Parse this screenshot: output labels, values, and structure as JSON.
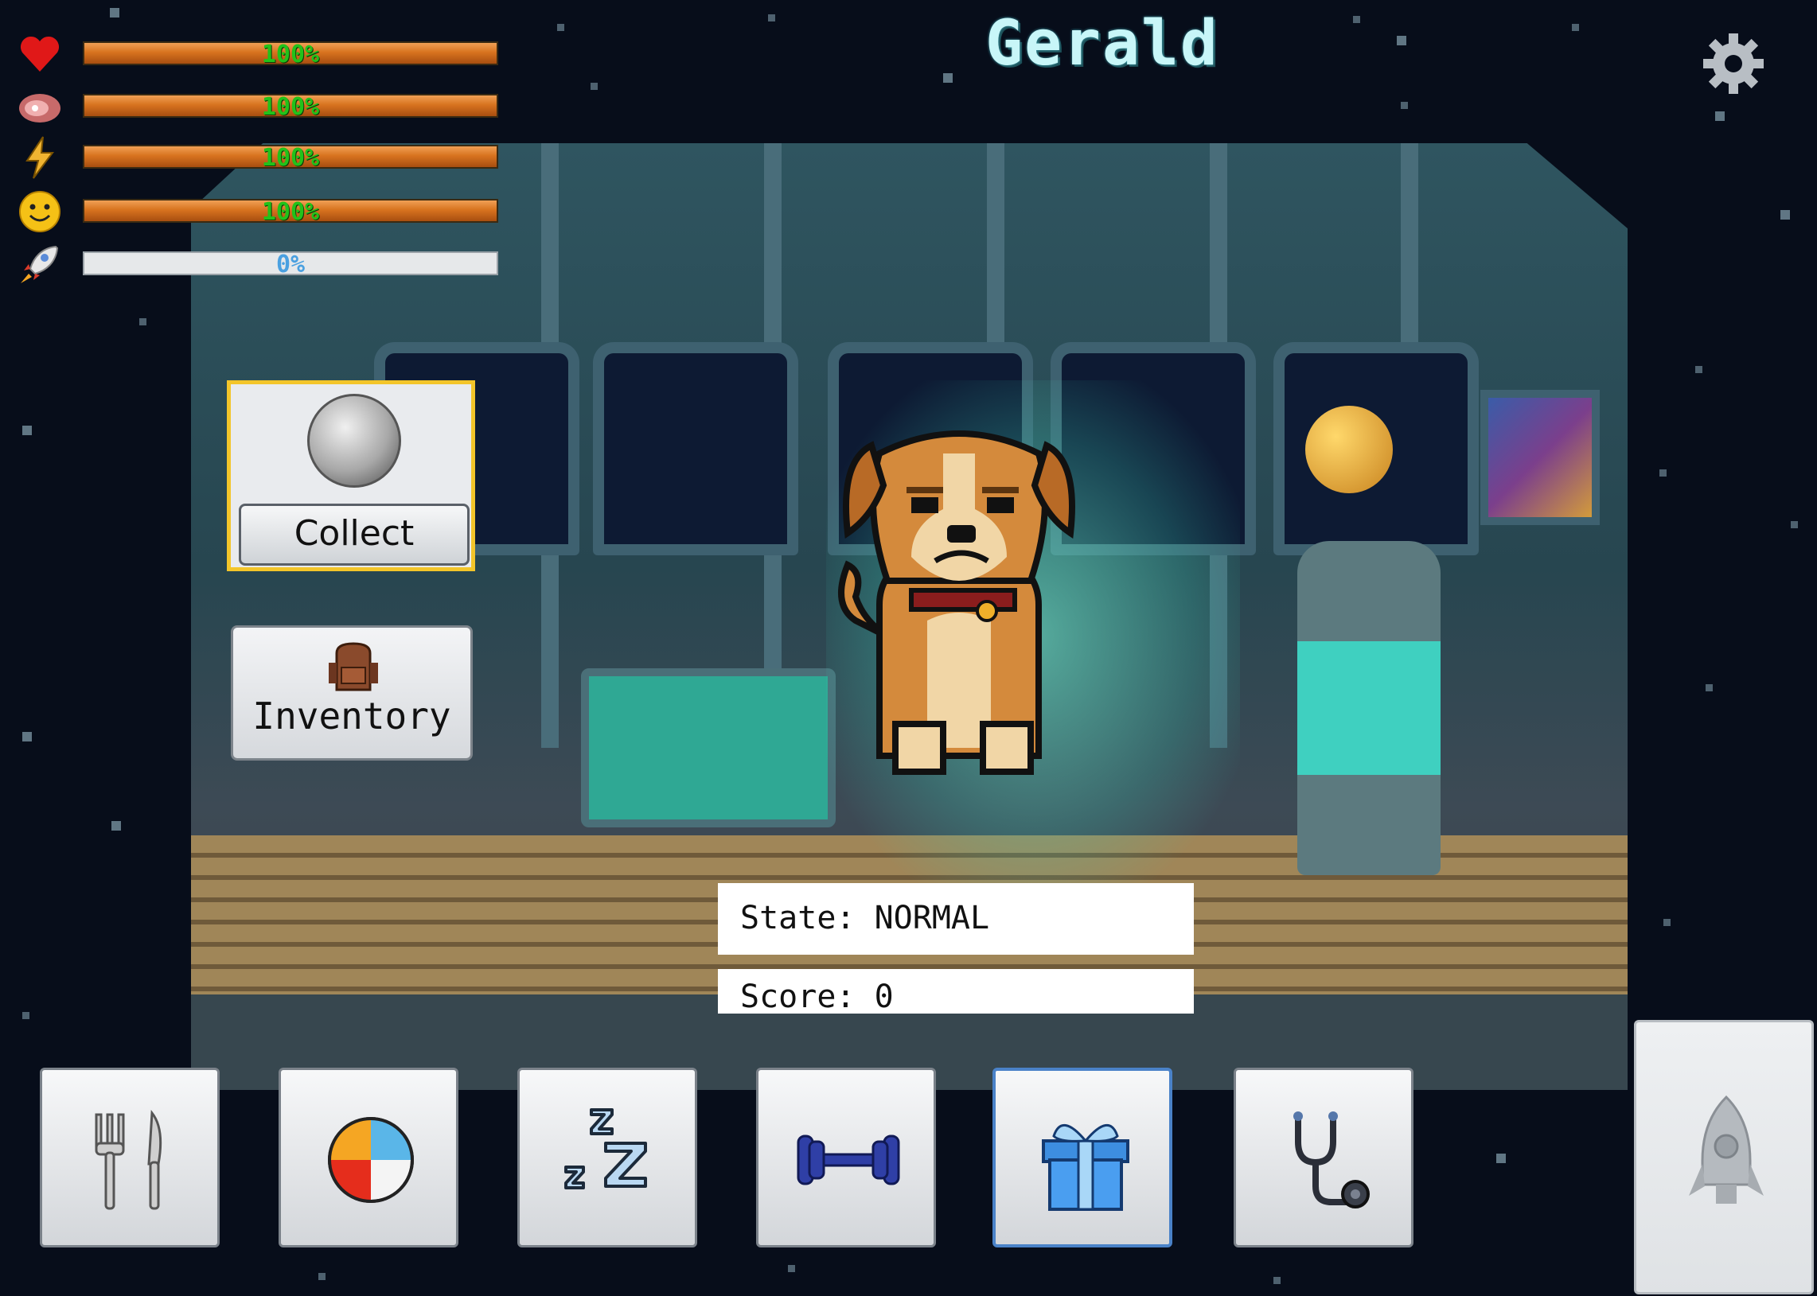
{
  "pet": {
    "name": "Gerald"
  },
  "stats": [
    {
      "name": "health",
      "icon": "heart-icon",
      "value_text": "100%",
      "value": 1.0
    },
    {
      "name": "hunger",
      "icon": "meat-icon",
      "value_text": "100%",
      "value": 1.0
    },
    {
      "name": "energy",
      "icon": "lightning-icon",
      "value_text": "100%",
      "value": 1.0
    },
    {
      "name": "happiness",
      "icon": "smiley-icon",
      "value_text": "100%",
      "value": 1.0
    },
    {
      "name": "launch-progress",
      "icon": "rocket-icon",
      "value_text": "0%",
      "value": 0.0
    }
  ],
  "collect": {
    "label": "Collect",
    "icon": "moon-icon"
  },
  "inventory": {
    "label": "Inventory",
    "icon": "backpack-icon"
  },
  "status": {
    "state": "State: NORMAL",
    "score": "Score: 0"
  },
  "actions": [
    {
      "name": "feed",
      "icon": "fork-knife-icon"
    },
    {
      "name": "play",
      "icon": "beach-ball-icon"
    },
    {
      "name": "sleep",
      "icon": "zzz-icon"
    },
    {
      "name": "exercise",
      "icon": "dumbbell-icon"
    },
    {
      "name": "gift",
      "icon": "gift-icon",
      "selected": true
    },
    {
      "name": "heal",
      "icon": "stethoscope-icon"
    }
  ],
  "launch": {
    "icon": "rocket-icon",
    "enabled": false
  },
  "colors": {
    "bar_fill": "#d8731f",
    "percent_text": "#22c21a",
    "selected_border": "#4a82c8",
    "highlight_border": "#f3c52a"
  }
}
